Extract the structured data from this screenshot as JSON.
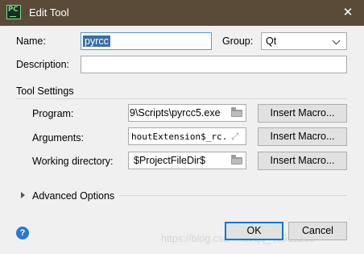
{
  "window": {
    "title": "Edit Tool",
    "app_icon_text": "PC",
    "close_glyph": "✕"
  },
  "form": {
    "name_label": "Name:",
    "name_value": "pyrcc",
    "group_label": "Group:",
    "group_value": "Qt",
    "description_label": "Description:",
    "description_value": ""
  },
  "tool_settings": {
    "section_title": "Tool Settings",
    "program_label": "Program:",
    "program_value": "9\\Scripts\\pyrcc5.exe",
    "arguments_label": "Arguments:",
    "arguments_value": "houtExtension$_rc.py",
    "workdir_label": "Working directory:",
    "workdir_value": "$ProjectFileDir$",
    "insert_macro_label": "Insert Macro..."
  },
  "advanced": {
    "label": "Advanced Options"
  },
  "footer": {
    "ok_label": "OK",
    "cancel_label": "Cancel",
    "help_glyph": "?",
    "watermark": "https://blog.csdn.net/qq_40911238"
  },
  "colors": {
    "titlebar": "#5a4a38",
    "selection": "#3a6ea5",
    "focus_border": "#0078d7",
    "help_icon": "#2a78d4"
  },
  "icons": {
    "app": "pycharm-logo-icon",
    "close": "close-icon",
    "folder": "folder-icon",
    "expand": "expand-field-icon",
    "chevron": "chevron-down-icon",
    "disclosure": "disclosure-triangle-icon",
    "help": "help-icon"
  }
}
